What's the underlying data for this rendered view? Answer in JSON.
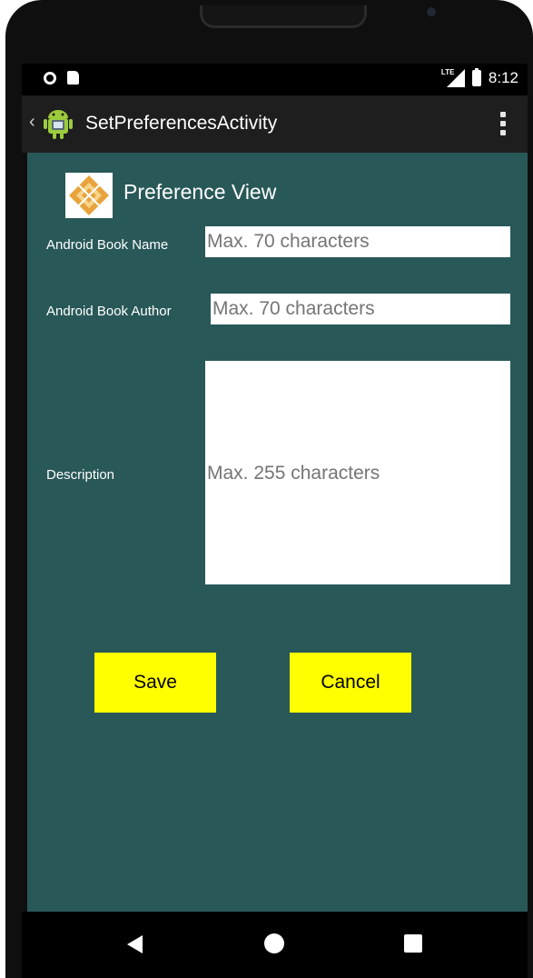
{
  "status_bar": {
    "network": "LTE",
    "time": "8:12"
  },
  "app_bar": {
    "title": "SetPreferencesActivity",
    "back_glyph": "‹"
  },
  "header": {
    "title": "Preference View"
  },
  "form": {
    "book_name": {
      "label": "Android Book Name",
      "placeholder": "Max. 70 characters",
      "value": ""
    },
    "book_author": {
      "label": "Android Book Author",
      "placeholder": "Max. 70 characters",
      "value": ""
    },
    "description": {
      "label": "Description",
      "placeholder": "Max. 255 characters",
      "value": ""
    }
  },
  "buttons": {
    "save": "Save",
    "cancel": "Cancel"
  },
  "colors": {
    "content_bg": "#295858",
    "button_bg": "#ffff00",
    "app_bar_bg": "#1e1e1e",
    "status_bar_bg": "#000000"
  },
  "icons": {
    "app": "android-icon",
    "logo": "diamond-logo-icon",
    "overflow": "overflow-menu-icon",
    "nav_back": "nav-back-icon",
    "nav_home": "nav-home-icon",
    "nav_recent": "nav-recent-icon"
  }
}
